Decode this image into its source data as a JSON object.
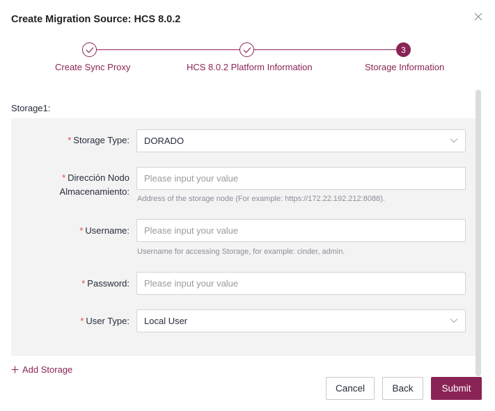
{
  "dialog": {
    "title": "Create Migration Source: HCS 8.0.2"
  },
  "stepper": {
    "steps": [
      {
        "label": "Create Sync Proxy",
        "status": "done"
      },
      {
        "label": "HCS 8.0.2 Platform Information",
        "status": "done"
      },
      {
        "label": "Storage Information",
        "status": "active",
        "number": "3"
      }
    ]
  },
  "storage": {
    "title": "Storage1:",
    "required_mark": "*",
    "fields": {
      "storage_type": {
        "label": "Storage Type:",
        "value": "DORADO"
      },
      "node_address": {
        "label_line1": "Dirección Nodo",
        "label_line2": "Almacenamiento:",
        "placeholder": "Please input your value",
        "hint": "Address of the storage node (For example: https://172.22.192.212:8088)."
      },
      "username": {
        "label": "Username:",
        "placeholder": "Please input your value",
        "hint": "Username for accessing Storage, for example: cinder, admin."
      },
      "password": {
        "label": "Password:",
        "placeholder": "Please input your value"
      },
      "user_type": {
        "label": "User Type:",
        "value": "Local User"
      }
    },
    "add_label": "Add Storage"
  },
  "footer": {
    "cancel_label": "Cancel",
    "back_label": "Back",
    "submit_label": "Submit"
  },
  "colors": {
    "accent": "#8a2456",
    "required": "#e54545",
    "panel_bg": "#f3f3f3"
  },
  "icons": {
    "close": "close-icon",
    "check": "check-icon",
    "chevron": "chevron-down-icon",
    "plus": "plus-icon"
  }
}
